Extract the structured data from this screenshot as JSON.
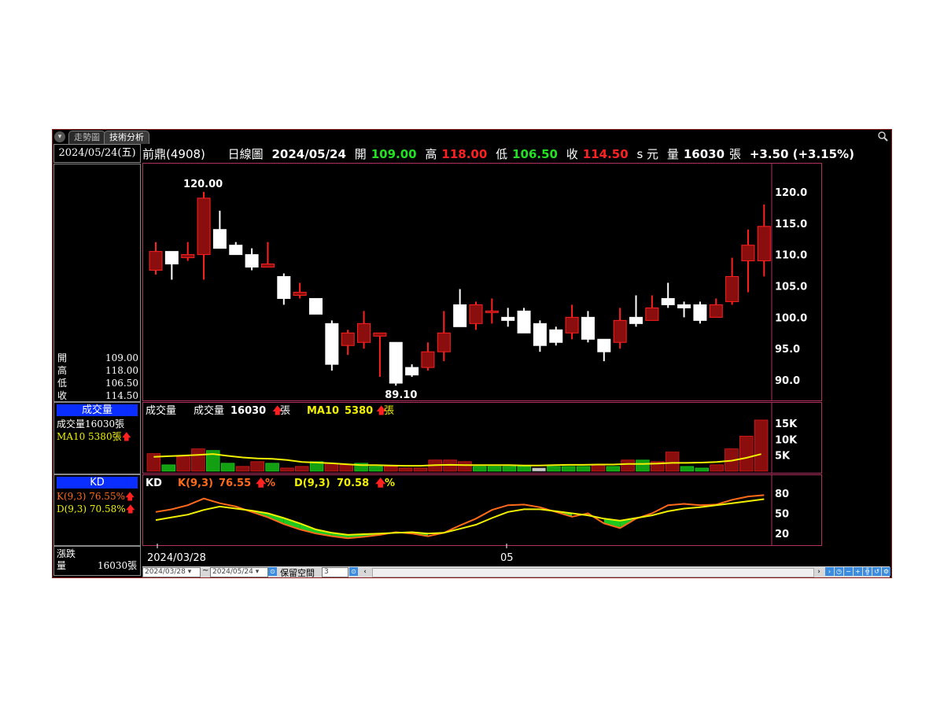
{
  "tabs": [
    {
      "label": "走勢圖"
    },
    {
      "label": "技術分析"
    }
  ],
  "left_panel": {
    "date": "2024/05/24(五)",
    "ohlc": [
      {
        "label": "開",
        "value": "109.00"
      },
      {
        "label": "高",
        "value": "118.00"
      },
      {
        "label": "低",
        "value": "106.50"
      },
      {
        "label": "收",
        "value": "114.50"
      }
    ],
    "volume_title": "成交量",
    "volume_line": "成交量16030張",
    "ma10_line": "MA10  5380張",
    "kd_title": "KD",
    "k_line": "K(9,3)  76.55%",
    "d_line": "D(9,3)  70.58%",
    "change_label": "漲跌",
    "volume_label": "量",
    "volume_value": "16030張"
  },
  "header": {
    "stock": "前鼎(4908)",
    "chart_type": "日線圖",
    "date": "2024/05/24",
    "open_label": "開",
    "open": "109.00",
    "high_label": "高",
    "high": "118.00",
    "low_label": "低",
    "low": "106.50",
    "close_label": "收",
    "close": "114.50",
    "suffix": "s 元",
    "vol_label": "量",
    "vol": "16030",
    "vol_unit": "張",
    "change": "+3.50 (+3.15%)"
  },
  "volume_header": {
    "name": "成交量",
    "label": "成交量",
    "value": "16030",
    "unit": "張",
    "ma_label": "MA10",
    "ma_value": "5380",
    "ma_unit": "張"
  },
  "kd_header": {
    "name": "KD",
    "k_label": "K(9,3)",
    "k_value": "76.55",
    "d_label": "D(9,3)",
    "d_value": "70.58",
    "unit": "%"
  },
  "annotations": {
    "high": "120.00",
    "low": "89.10"
  },
  "x_labels": [
    "2024/03/28",
    "05"
  ],
  "bottom_bar": {
    "from_date": "2024/03/28",
    "to_date": "2024/05/24",
    "separator": "~",
    "keep_space_label": "保留空間",
    "keep_space_value": "3"
  },
  "colors": {
    "up": "#8b0e0e",
    "up_edge": "#ff2020",
    "down": "#ffffff",
    "vol_up": "#8b0e0e",
    "vol_down": "#12a012",
    "k_line": "#ff6a1a",
    "d_line": "#f0f000",
    "pane_border": "#b03060"
  },
  "chart_data": [
    {
      "type": "candlestick",
      "y_ticks": [
        "120.0",
        "115.0",
        "110.0",
        "105.0",
        "100.0",
        "95.0",
        "90.0"
      ],
      "ylim": [
        87.5,
        123.5
      ],
      "candles": [
        {
          "o": 107.5,
          "h": 112,
          "l": 106.8,
          "c": 110.5
        },
        {
          "o": 110.5,
          "h": 110.5,
          "l": 106,
          "c": 108.5
        },
        {
          "o": 109.5,
          "h": 112,
          "l": 109,
          "c": 110
        },
        {
          "o": 110,
          "h": 120,
          "l": 106,
          "c": 119
        },
        {
          "o": 114,
          "h": 117,
          "l": 111,
          "c": 111
        },
        {
          "o": 111.5,
          "h": 112,
          "l": 110,
          "c": 110
        },
        {
          "o": 110,
          "h": 111,
          "l": 107.5,
          "c": 108
        },
        {
          "o": 108,
          "h": 112,
          "l": 108,
          "c": 108.5
        },
        {
          "o": 106.5,
          "h": 107,
          "l": 102,
          "c": 103
        },
        {
          "o": 103.5,
          "h": 105.5,
          "l": 103,
          "c": 104
        },
        {
          "o": 103,
          "h": 103,
          "l": 100.5,
          "c": 100.5
        },
        {
          "o": 99,
          "h": 99.5,
          "l": 91.5,
          "c": 92.5
        },
        {
          "o": 95.5,
          "h": 98,
          "l": 94,
          "c": 97.5
        },
        {
          "o": 96,
          "h": 101,
          "l": 95,
          "c": 99
        },
        {
          "o": 97,
          "h": 97.5,
          "l": 90.5,
          "c": 97.5
        },
        {
          "o": 96,
          "h": 96,
          "l": 89.1,
          "c": 89.5
        },
        {
          "o": 92,
          "h": 92.5,
          "l": 90.5,
          "c": 90.8
        },
        {
          "o": 92,
          "h": 96,
          "l": 91.5,
          "c": 94.5
        },
        {
          "o": 94.5,
          "h": 101,
          "l": 93,
          "c": 97.5
        },
        {
          "o": 102,
          "h": 104.5,
          "l": 98.5,
          "c": 98.5
        },
        {
          "o": 99,
          "h": 102.5,
          "l": 98,
          "c": 102
        },
        {
          "o": 101,
          "h": 103,
          "l": 99,
          "c": 101
        },
        {
          "o": 100,
          "h": 101.5,
          "l": 98.5,
          "c": 99.5
        },
        {
          "o": 101,
          "h": 101.5,
          "l": 97.5,
          "c": 97.5
        },
        {
          "o": 99,
          "h": 99.5,
          "l": 94.5,
          "c": 95.5
        },
        {
          "o": 98,
          "h": 98.5,
          "l": 95.5,
          "c": 96
        },
        {
          "o": 97.5,
          "h": 102,
          "l": 96.5,
          "c": 100
        },
        {
          "o": 100,
          "h": 101,
          "l": 96,
          "c": 96.5
        },
        {
          "o": 96.5,
          "h": 96.5,
          "l": 93,
          "c": 94.5
        },
        {
          "o": 96,
          "h": 101.5,
          "l": 95,
          "c": 99.5
        },
        {
          "o": 100,
          "h": 103.5,
          "l": 98.5,
          "c": 99
        },
        {
          "o": 99.5,
          "h": 103.5,
          "l": 99.5,
          "c": 101.5
        },
        {
          "o": 103,
          "h": 105.5,
          "l": 101.5,
          "c": 102
        },
        {
          "o": 102,
          "h": 102.5,
          "l": 100,
          "c": 101.5
        },
        {
          "o": 102,
          "h": 102.5,
          "l": 99,
          "c": 99.5
        },
        {
          "o": 100,
          "h": 103,
          "l": 100,
          "c": 102
        },
        {
          "o": 102.5,
          "h": 109.5,
          "l": 102,
          "c": 106.5
        },
        {
          "o": 109,
          "h": 114,
          "l": 104,
          "c": 111.5
        },
        {
          "o": 109,
          "h": 118,
          "l": 106.5,
          "c": 114.5
        }
      ]
    },
    {
      "type": "bar",
      "y_ticks": [
        "15K",
        "10K",
        "5K"
      ],
      "ylim": [
        0,
        17000
      ],
      "volumes": [
        5500,
        2000,
        4500,
        7000,
        6500,
        2500,
        1500,
        3000,
        2500,
        1000,
        1500,
        3000,
        2500,
        2000,
        2500,
        1500,
        1500,
        1000,
        1000,
        3500,
        3500,
        3000,
        1500,
        1500,
        1500,
        1500,
        1000,
        1500,
        1500,
        1500,
        2000,
        1500,
        3500,
        3500,
        3000,
        6000,
        1500,
        1000,
        2000,
        7000,
        11000,
        16030
      ],
      "vol_up": [
        true,
        false,
        true,
        true,
        false,
        false,
        true,
        true,
        false,
        true,
        true,
        false,
        true,
        true,
        false,
        false,
        true,
        true,
        true,
        true,
        true,
        true,
        false,
        false,
        false,
        false,
        null,
        false,
        false,
        false,
        true,
        false,
        true,
        false,
        true,
        true,
        false,
        false,
        true,
        true,
        true,
        true
      ],
      "ma10": [
        4500,
        4700,
        4900,
        5100,
        5400,
        4800,
        4300,
        4000,
        3900,
        3500,
        2900,
        2700,
        2500,
        2200,
        1900,
        1900,
        1800,
        1700,
        1700,
        1900,
        2000,
        1900,
        1900,
        1900,
        1900,
        1800,
        1800,
        1900,
        2000,
        2000,
        2100,
        2100,
        2300,
        2300,
        2400,
        2600,
        2600,
        2700,
        2900,
        3300,
        4200,
        5380
      ]
    },
    {
      "type": "line",
      "y_ticks": [
        "80",
        "50",
        "20"
      ],
      "ylim": [
        5,
        95
      ],
      "series": [
        {
          "name": "K(9,3)",
          "values": [
            52,
            56,
            62,
            72,
            65,
            60,
            52,
            44,
            34,
            26,
            20,
            16,
            13,
            15,
            18,
            22,
            20,
            16,
            21,
            32,
            42,
            55,
            62,
            63,
            59,
            52,
            45,
            50,
            35,
            28,
            42,
            50,
            62,
            64,
            62,
            63,
            70,
            75,
            77
          ]
        },
        {
          "name": "D(9,3)",
          "values": [
            40,
            44,
            48,
            55,
            60,
            57,
            54,
            50,
            43,
            35,
            26,
            21,
            18,
            19,
            20,
            21,
            22,
            20,
            21,
            27,
            33,
            43,
            52,
            56,
            56,
            53,
            50,
            47,
            42,
            39,
            43,
            47,
            53,
            57,
            59,
            62,
            65,
            68,
            71
          ]
        }
      ]
    }
  ]
}
